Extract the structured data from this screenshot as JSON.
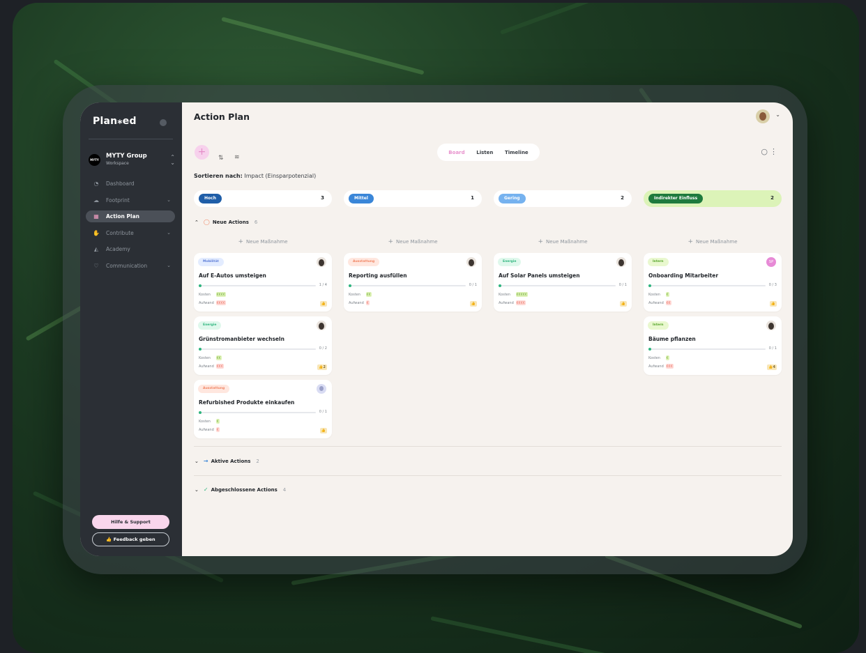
{
  "app": {
    "logo": "Plan⁎ed",
    "page_title": "Action Plan"
  },
  "workspace": {
    "avatar_text": "MYTY",
    "name": "MYTY Group",
    "type": "Workspace"
  },
  "sidebar": {
    "items": [
      {
        "label": "Dashboard",
        "icon": "dashboard-icon",
        "active": false
      },
      {
        "label": "Footprint",
        "icon": "cloud-icon",
        "active": false,
        "expandable": true
      },
      {
        "label": "Action Plan",
        "icon": "calendar-icon",
        "active": true
      },
      {
        "label": "Contribute",
        "icon": "hand-icon",
        "active": false,
        "expandable": true
      },
      {
        "label": "Academy",
        "icon": "academy-icon",
        "active": false
      },
      {
        "label": "Communication",
        "icon": "heart-icon",
        "active": false,
        "expandable": true
      }
    ],
    "help_label": "Hilfe & Support",
    "feedback_label": "👍 Feedback geben"
  },
  "toolbar": {
    "views": [
      "Board",
      "Listen",
      "Timeline"
    ],
    "active_view": "Board",
    "sort_prefix": "Sortieren nach:",
    "sort_value": "Impact (Einsparpotenzial)"
  },
  "columns": [
    {
      "label": "Hoch",
      "count": "3",
      "chip_color": "#1f5ea8"
    },
    {
      "label": "Mittel",
      "count": "1",
      "chip_color": "#3a86d8"
    },
    {
      "label": "Gering",
      "count": "2",
      "chip_color": "#76b2ef"
    },
    {
      "label": "Indirekter Einfluss",
      "count": "2",
      "chip_color": "#1e7a3d"
    }
  ],
  "sections": [
    {
      "label": "Neue Actions",
      "count": "6"
    },
    {
      "label": "Aktive Actions",
      "count": "2"
    },
    {
      "label": "Abgeschlossene Actions",
      "count": "4"
    }
  ],
  "new_measure_label": "Neue Maßnahme",
  "labels": {
    "cost": "Kosten",
    "effort": "Aufwand"
  },
  "cards": [
    {
      "tag": "Mobilität",
      "tag_style": "mob",
      "title": "Auf E-Autos umsteigen",
      "progress": "1 / 4",
      "cost": "€€€€",
      "effort": "€€€€",
      "badge": "👍"
    },
    {
      "tag": "Energie",
      "tag_style": "ene",
      "title": "Grünstromanbieter wechseln",
      "progress": "0 / 2",
      "cost": "€€",
      "effort": "€€€",
      "badge": "👍2"
    },
    {
      "tag": "Ausstattung",
      "tag_style": "aus",
      "title": "Refurbished Produkte einkaufen",
      "progress": "0 / 1",
      "cost": "€",
      "effort": "€",
      "badge": "👍"
    },
    {
      "tag": "Ausstattung",
      "tag_style": "aus",
      "title": "Reporting ausfüllen",
      "progress": "0 / 1",
      "cost": "€€",
      "effort": "€",
      "badge": "👍"
    },
    {
      "tag": "Energie",
      "tag_style": "ene",
      "title": "Auf Solar Panels umsteigen",
      "progress": "0 / 1",
      "cost": "€€€€€",
      "effort": "€€€€",
      "badge": "👍"
    },
    {
      "tag": "Intern",
      "tag_style": "int",
      "title": "Onboarding Mitarbeiter",
      "progress": "0 / 3",
      "cost": "€",
      "effort": "€€",
      "badge": "👍",
      "avatar_initials": "SP"
    },
    {
      "tag": "Intern",
      "tag_style": "int",
      "title": "Bäume pflanzen",
      "progress": "0 / 1",
      "cost": "€",
      "effort": "€€€",
      "badge": "👍4"
    }
  ]
}
